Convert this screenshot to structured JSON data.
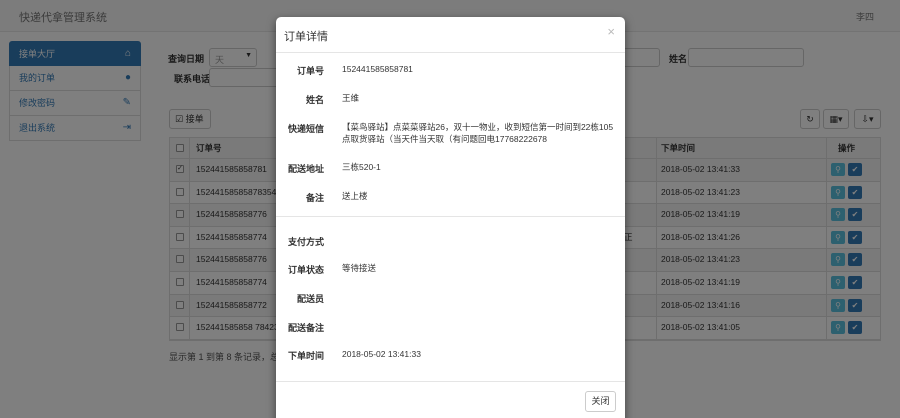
{
  "header": {
    "brand": "快递代拿管理系统",
    "user": "李四"
  },
  "sidebar": {
    "items": [
      {
        "label": "接单大厅",
        "icon": "home-icon"
      },
      {
        "label": "我的订单",
        "icon": "user-icon"
      },
      {
        "label": "修改密码",
        "icon": "pencil-icon"
      },
      {
        "label": "退出系统",
        "icon": "logout-icon"
      }
    ]
  },
  "search": {
    "date_label": "查询日期",
    "date_value": "天",
    "name_label": "姓名",
    "phone_label": "联系电话"
  },
  "toolbar": {
    "accept_label": "接单"
  },
  "table": {
    "headers": {
      "order_no": "订单号",
      "order_time": "下单时间",
      "actions": "操作"
    },
    "rows": [
      {
        "order_no": "1524415858587​81",
        "time": "2018-05-02 13:41:33",
        "checked": true
      },
      {
        "order_no": "1524415858587835​4",
        "time": "2018-05-02 13:41:23",
        "checked": false
      },
      {
        "order_no": "152441585858776",
        "time": "2018-05-02 13:41:19",
        "checked": false
      },
      {
        "order_no": "152441585858774",
        "time": "2018-05-02 13:41:26",
        "checked": false,
        "extra": "正"
      },
      {
        "order_no": "152441585858776",
        "time": "2018-05-02 13:41:23",
        "checked": false
      },
      {
        "order_no": "152441585858774",
        "time": "2018-05-02 13:41:19",
        "checked": false
      },
      {
        "order_no": "152441585858772",
        "time": "2018-05-02 13:41:16",
        "checked": false
      },
      {
        "order_no": "152441585858 7842​3",
        "time": "2018-05-02 13:41:05",
        "checked": false
      }
    ],
    "footer": "显示第 1 到第 8 条记录，总共"
  },
  "modal": {
    "title": "订单详情",
    "close_symbol": "×",
    "fields": {
      "order_no_label": "订单号",
      "order_no": "152441585858781",
      "name_label": "姓名",
      "name": "王维",
      "express_label": "快递短信",
      "express": "【菜鸟驿站】点菜菜驿站26，双十一物业，收到短信第一时间到22栋105点取货驿站（当天件当天取（有问题回电17768222678",
      "address_label": "配送地址",
      "address": "三栋520-1",
      "remark_label": "备注",
      "remark": "送上楼",
      "pay_label": "支付方式",
      "pay": "",
      "status_label": "订单状态",
      "status": "等待接送",
      "courier_label": "配送员",
      "courier": "",
      "courier_remark_label": "配送备注",
      "courier_remark": "",
      "time_label": "下单时间",
      "time": "2018-05-02 13:41:33"
    },
    "close_button": "关闭"
  },
  "colors": {
    "primary": "#337ab7",
    "info": "#5bc0de",
    "backdrop": "rgba(0,0,0,0.5)"
  }
}
